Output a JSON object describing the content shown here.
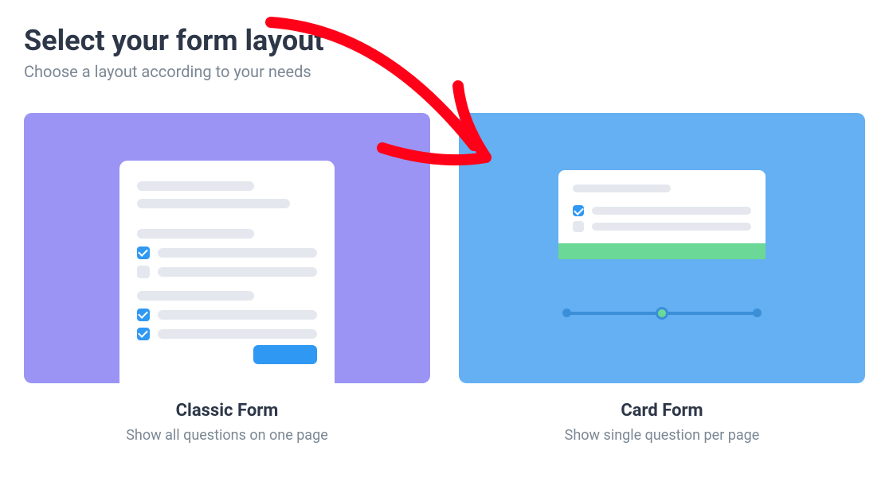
{
  "header": {
    "title": "Select your form layout",
    "subtitle": "Choose a layout according to your needs"
  },
  "options": {
    "classic": {
      "title": "Classic Form",
      "description": "Show all questions on one page"
    },
    "card": {
      "title": "Card Form",
      "description": "Show single question per page"
    }
  },
  "annotation": {
    "arrow": "red-arrow-pointing-to-card-form"
  }
}
